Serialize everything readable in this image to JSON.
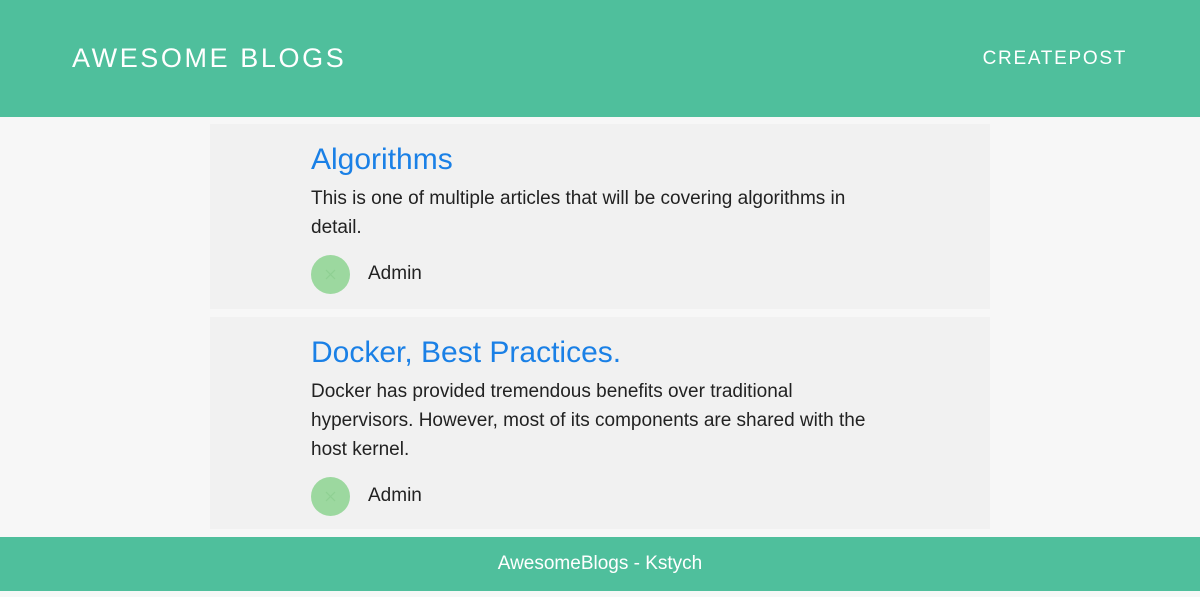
{
  "header": {
    "brand": "AWESOME BLOGS",
    "nav_create": "CREATEPOST"
  },
  "posts": [
    {
      "title": "Algorithms",
      "excerpt": "This is one of multiple articles that will be covering algorithms in detail.",
      "author": "Admin"
    },
    {
      "title": "Docker, Best Practices.",
      "excerpt": "Docker has provided tremendous benefits over traditional hypervisors. However, most of its components are shared with the host kernel.",
      "author": "Admin"
    }
  ],
  "footer": {
    "text": "AwesomeBlogs - Kstych"
  },
  "colors": {
    "brand_green": "#4fbf9c",
    "title_blue": "#1a80e6",
    "avatar_green": "#9cd89f",
    "card_bg": "#f1f1f1",
    "page_bg": "#f7f7f7"
  },
  "icons": {
    "avatar": "broken-image-avatar-icon"
  }
}
